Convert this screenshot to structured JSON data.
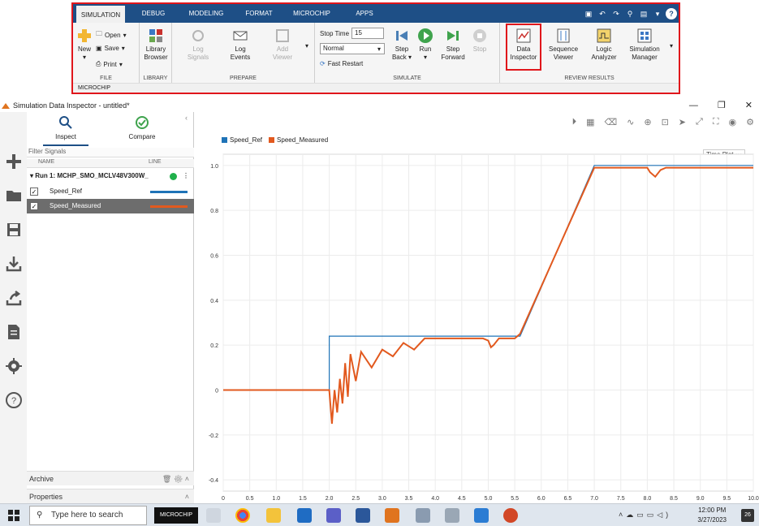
{
  "ribbon": {
    "tabs": [
      "SIMULATION",
      "DEBUG",
      "MODELING",
      "FORMAT",
      "MICROCHIP",
      "APPS"
    ],
    "active_tab": "SIMULATION",
    "file": {
      "new": "New",
      "open": "Open",
      "save": "Save",
      "print": "Print",
      "title": "FILE"
    },
    "library": {
      "browser": "Library Browser",
      "title": "LIBRARY"
    },
    "prepare": {
      "log_signals": "Log Signals",
      "log_events": "Log Events",
      "add_viewer": "Add Viewer",
      "title": "PREPARE"
    },
    "simulate": {
      "stop_time_label": "Stop Time",
      "stop_time_value": "15",
      "mode": "Normal",
      "fast_restart": "Fast Restart",
      "step_back": "Step Back",
      "run": "Run",
      "step_forward": "Step Forward",
      "stop": "Stop",
      "title": "SIMULATE"
    },
    "review": {
      "data_inspector": "Data Inspector",
      "sequence_viewer": "Sequence Viewer",
      "logic_analyzer": "Logic Analyzer",
      "simulation_manager": "Simulation Manager",
      "title": "REVIEW RESULTS"
    },
    "footer": "MICROCHIP"
  },
  "window": {
    "title": "Simulation Data Inspector - untitled*"
  },
  "panel": {
    "tabs": [
      "Inspect",
      "Compare"
    ],
    "filter_placeholder": "Filter Signals",
    "col_name": "NAME",
    "col_line": "LINE",
    "run_label": "Run 1: MCHP_SMO_MCLV48V300W_",
    "signals": [
      {
        "name": "Speed_Ref",
        "checked": true,
        "color": "#1f73b7"
      },
      {
        "name": "Speed_Measured",
        "checked": true,
        "color": "#e2591e"
      }
    ],
    "archive": "Archive",
    "properties": "Properties"
  },
  "plot": {
    "time_plot_label": "Time Plot"
  },
  "chart_data": {
    "type": "line",
    "title": "",
    "xlabel": "",
    "ylabel": "",
    "xlim": [
      0,
      10
    ],
    "ylim": [
      -0.45,
      1.05
    ],
    "x_ticks": [
      "0",
      "0.5",
      "1.0",
      "1.5",
      "2.0",
      "2.5",
      "3.0",
      "3.5",
      "4.0",
      "4.5",
      "5.0",
      "5.5",
      "6.0",
      "6.5",
      "7.0",
      "7.5",
      "8.0",
      "8.5",
      "9.0",
      "9.5",
      "10.0"
    ],
    "y_ticks": [
      "-0.4",
      "-0.2",
      "0",
      "0.2",
      "0.4",
      "0.6",
      "0.8",
      "1.0"
    ],
    "legend": [
      "Speed_Ref",
      "Speed_Measured"
    ],
    "legend_position": "top-left",
    "series": [
      {
        "name": "Speed_Ref",
        "color": "#1f73b7",
        "x": [
          0,
          2.0,
          2.0,
          5.6,
          7.0,
          10.0
        ],
        "y": [
          0,
          0,
          0.24,
          0.24,
          1.0,
          1.0
        ]
      },
      {
        "name": "Speed_Measured",
        "color": "#e2591e",
        "x": [
          0,
          2.0,
          2.05,
          2.1,
          2.15,
          2.2,
          2.25,
          2.3,
          2.35,
          2.4,
          2.5,
          2.6,
          2.8,
          3.0,
          3.2,
          3.4,
          3.6,
          3.8,
          4.0,
          4.5,
          4.9,
          5.0,
          5.05,
          5.1,
          5.2,
          5.5,
          5.6,
          7.0,
          7.1,
          8.0,
          8.05,
          8.15,
          8.25,
          8.35,
          8.5,
          10.0
        ],
        "y": [
          0,
          0,
          -0.15,
          0.0,
          -0.1,
          0.05,
          -0.06,
          0.12,
          -0.03,
          0.16,
          0.04,
          0.17,
          0.1,
          0.18,
          0.15,
          0.21,
          0.18,
          0.23,
          0.23,
          0.23,
          0.23,
          0.22,
          0.19,
          0.2,
          0.23,
          0.23,
          0.25,
          0.99,
          0.99,
          0.99,
          0.97,
          0.95,
          0.98,
          0.99,
          0.99,
          0.99
        ]
      }
    ]
  },
  "taskbar": {
    "search_placeholder": "Type here to search",
    "brand": "MICROCHIP",
    "time": "12:00 PM",
    "date": "3/27/2023",
    "notifications": "26"
  }
}
